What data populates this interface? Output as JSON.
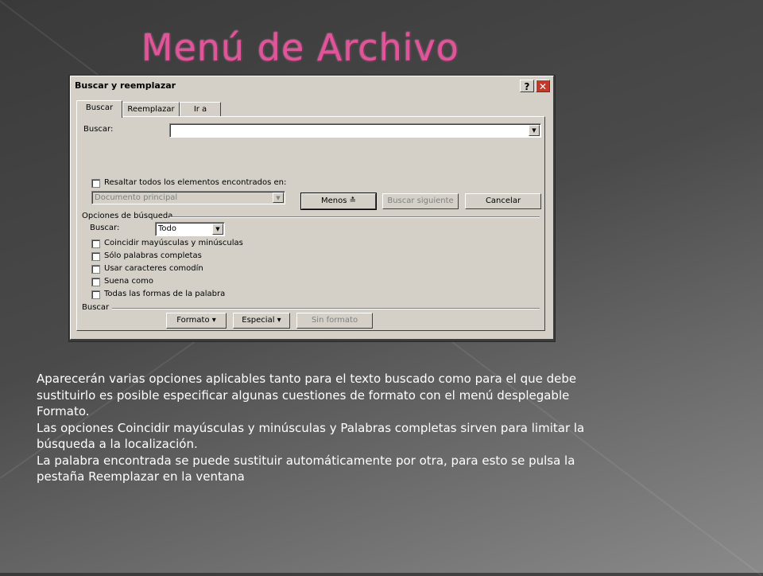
{
  "slide": {
    "title": "Menú de Archivo",
    "paragraphs": [
      "Aparecerán varias opciones aplicables tanto para el texto buscado como para el que debe sustituirlo es posible especificar algunas cuestiones de formato con el menú desplegable Formato.",
      "Las opciones Coincidir mayúsculas y minúsculas y Palabras completas sirven para limitar la búsqueda a la localización.",
      "La palabra encontrada se puede sustituir automáticamente por otra, para esto se pulsa la pestaña Reemplazar en la ventana"
    ]
  },
  "dialog": {
    "title": "Buscar y reemplazar",
    "help_label": "?",
    "close_label": "✕",
    "tabs": [
      {
        "label": "Buscar",
        "active": true
      },
      {
        "label": "Reemplazar",
        "active": false
      },
      {
        "label": "Ir a",
        "active": false
      }
    ],
    "find_label": "Buscar:",
    "find_value": "",
    "highlight_label": "Resaltar todos los elementos encontrados en:",
    "highlight_scope": "Documento principal",
    "buttons": {
      "less": "Menos ≛",
      "find_next": "Buscar siguiente",
      "cancel": "Cancelar"
    },
    "options_group": "Opciones de búsqueda",
    "search_dir_label": "Buscar:",
    "search_dir_value": "Todo",
    "options": [
      "Coincidir mayúsculas y minúsculas",
      "Sólo palabras completas",
      "Usar caracteres comodín",
      "Suena como",
      "Todas las formas de la palabra"
    ],
    "search_group": "Buscar",
    "bottom_buttons": {
      "format": "Formato ▾",
      "special": "Especial ▾",
      "no_format": "Sin formato"
    }
  }
}
